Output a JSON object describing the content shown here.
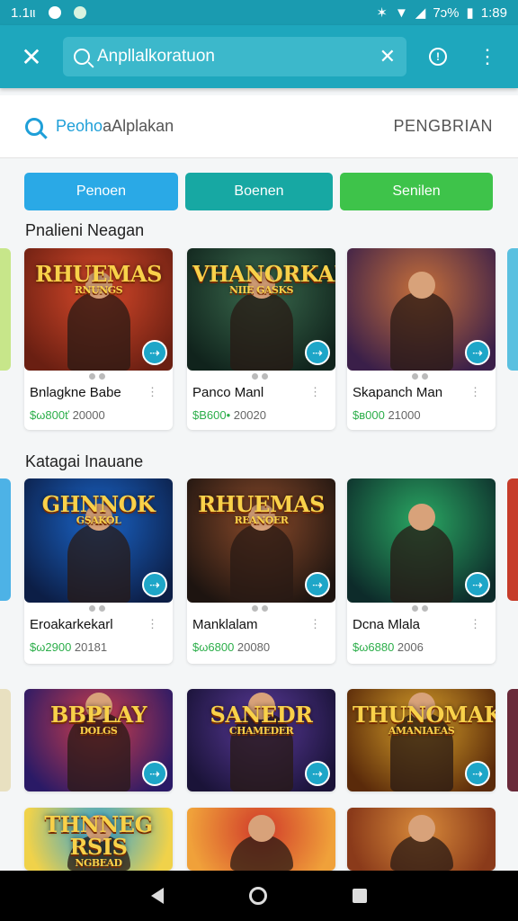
{
  "status_bar": {
    "time_left": "1.1ιι",
    "battery": "7ɔ%",
    "time_right": "1:89"
  },
  "app_bar": {
    "search_value": "Anpllalkoratuon"
  },
  "search_bar": {
    "prefix": "Peoho",
    "placeholder": "aAlplakan",
    "action": "PENGBRIAN"
  },
  "chips": [
    {
      "label": "Penoen",
      "color": "#2aa9e6"
    },
    {
      "label": "Boenen",
      "color": "#17a8a3"
    },
    {
      "label": "Senilen",
      "color": "#3ec34a"
    }
  ],
  "sections": [
    {
      "title": "Pnalieni Neagan",
      "cards": [
        {
          "logo": "RHUEMAS\nRNUNGS",
          "name": "Bnlagkne Babe",
          "price": "$ω800ť",
          "downloads": "20000",
          "colors": [
            "#d8492a",
            "#6a1f12"
          ]
        },
        {
          "logo": "VHANORKAK\nNIIE GASKS",
          "name": "Panco Manl",
          "price": "$В600•",
          "downloads": "20020",
          "colors": [
            "#3b6b4e",
            "#10231c"
          ]
        },
        {
          "logo": "",
          "name": "Skapanch Man",
          "price": "$в000",
          "downloads": "21000",
          "colors": [
            "#c7703a",
            "#3a1f49"
          ]
        }
      ]
    },
    {
      "title": "Katagai Inauane",
      "cards": [
        {
          "logo": "GHNNOK\nGSAKOL",
          "name": "Eroakarkekarl",
          "price": "$ω2900",
          "downloads": "20181",
          "colors": [
            "#1a65c9",
            "#0c1e46"
          ]
        },
        {
          "logo": "RHUEMAS\nREANOER",
          "name": "Manklalam",
          "price": "$ω6800",
          "downloads": "20080",
          "colors": [
            "#8a4a2a",
            "#1d1410"
          ]
        },
        {
          "logo": "",
          "name": "Dcna Mlala",
          "price": "$ω6880",
          "downloads": "2006",
          "colors": [
            "#2aa863",
            "#0d2b2a"
          ]
        }
      ]
    },
    {
      "title": "",
      "cards": [
        {
          "logo": "BBPLAY\nDOLGS",
          "name": "",
          "price": "",
          "downloads": "",
          "colors": [
            "#d03e4a",
            "#2a1a66"
          ]
        },
        {
          "logo": "SANEDR\nCHAMEDER",
          "name": "",
          "price": "",
          "downloads": "",
          "colors": [
            "#5a3a9a",
            "#1a1338"
          ]
        },
        {
          "logo": "THUNOMAK\nAMANIAEAS",
          "name": "",
          "price": "",
          "downloads": "",
          "colors": [
            "#d8a12a",
            "#5a2a0a"
          ]
        }
      ]
    },
    {
      "title": "",
      "cards": [
        {
          "logo": "THNNEG RSIS\nNGBEAD",
          "name": "",
          "price": "",
          "downloads": "",
          "colors": [
            "#2aa0d8",
            "#f0d24a"
          ]
        },
        {
          "logo": "",
          "name": "",
          "price": "",
          "downloads": "",
          "colors": [
            "#d03a2a",
            "#f0a13a"
          ]
        },
        {
          "logo": "",
          "name": "",
          "price": "",
          "downloads": "",
          "colors": [
            "#d88a3a",
            "#8a3a1a"
          ]
        }
      ]
    }
  ]
}
